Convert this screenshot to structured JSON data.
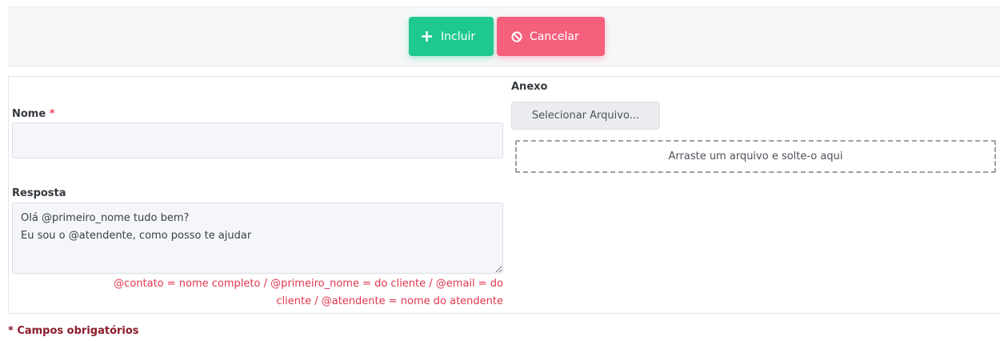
{
  "toolbar": {
    "include_label": "Incluir",
    "include_icon": "plus-icon",
    "cancel_label": "Cancelar",
    "cancel_icon": "ban-icon"
  },
  "form": {
    "name": {
      "label": "Nome",
      "required_marker": "*",
      "value": ""
    },
    "response": {
      "label": "Resposta",
      "value": "Olá @primeiro_nome tudo bem?\nEu sou o @atendente, como posso te ajudar",
      "help_line1": "@contato = nome completo / @primeiro_nome = do cliente / @email = do",
      "help_line2": "cliente / @atendente = nome do atendente"
    },
    "attachment": {
      "label": "Anexo",
      "select_button": "Selecionar Arquivo...",
      "dropzone_text": "Arraste um arquivo e solte-o aqui"
    }
  },
  "footer": {
    "required_note": "* Campos obrigatórios"
  },
  "colors": {
    "include": "#1ec991",
    "cancel": "#f5607c",
    "required": "#e9455f",
    "help_text": "#e0364f",
    "footer_note": "#8a1c2b"
  }
}
